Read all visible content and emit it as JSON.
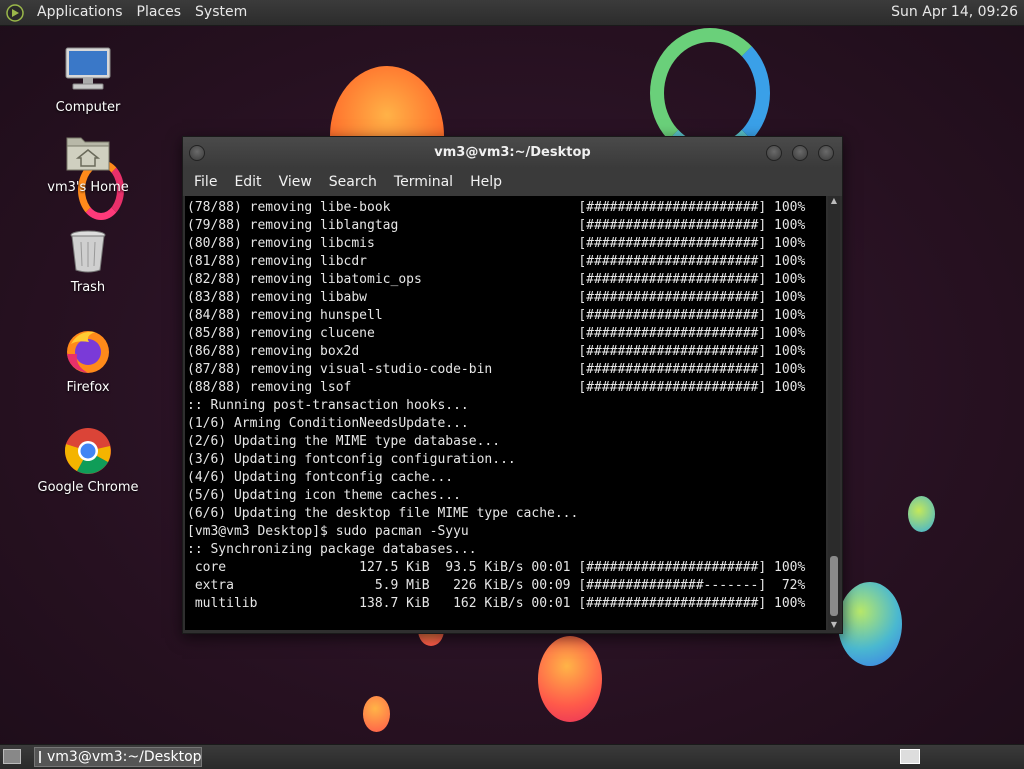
{
  "top_panel": {
    "menus": [
      "Applications",
      "Places",
      "System"
    ],
    "clock": "Sun Apr 14, 09:26"
  },
  "desktop_icons": [
    {
      "label": "Computer",
      "icon": "computer-icon"
    },
    {
      "label": "vm3's Home",
      "icon": "home-folder-icon"
    },
    {
      "label": "Trash",
      "icon": "trash-icon"
    },
    {
      "label": "Firefox",
      "icon": "firefox-icon"
    },
    {
      "label": "Google Chrome",
      "icon": "chrome-icon"
    }
  ],
  "window": {
    "title": "vm3@vm3:~/Desktop",
    "menus": [
      "File",
      "Edit",
      "View",
      "Search",
      "Terminal",
      "Help"
    ],
    "terminal_lines": [
      "(78/88) removing libe-book                        [######################] 100%",
      "(79/88) removing liblangtag                       [######################] 100%",
      "(80/88) removing libcmis                          [######################] 100%",
      "(81/88) removing libcdr                           [######################] 100%",
      "(82/88) removing libatomic_ops                    [######################] 100%",
      "(83/88) removing libabw                           [######################] 100%",
      "(84/88) removing hunspell                         [######################] 100%",
      "(85/88) removing clucene                          [######################] 100%",
      "(86/88) removing box2d                            [######################] 100%",
      "(87/88) removing visual-studio-code-bin           [######################] 100%",
      "(88/88) removing lsof                             [######################] 100%",
      ":: Running post-transaction hooks...",
      "(1/6) Arming ConditionNeedsUpdate...",
      "(2/6) Updating the MIME type database...",
      "(3/6) Updating fontconfig configuration...",
      "(4/6) Updating fontconfig cache...",
      "(5/6) Updating icon theme caches...",
      "(6/6) Updating the desktop file MIME type cache...",
      "[vm3@vm3 Desktop]$ sudo pacman -Syyu",
      ":: Synchronizing package databases...",
      " core                 127.5 KiB  93.5 KiB/s 00:01 [######################] 100%",
      " extra                  5.9 MiB   226 KiB/s 00:09 [###############-------]  72%",
      " multilib             138.7 KiB   162 KiB/s 00:01 [######################] 100%"
    ]
  },
  "taskbar": {
    "task_label": "vm3@vm3:~/Desktop"
  }
}
